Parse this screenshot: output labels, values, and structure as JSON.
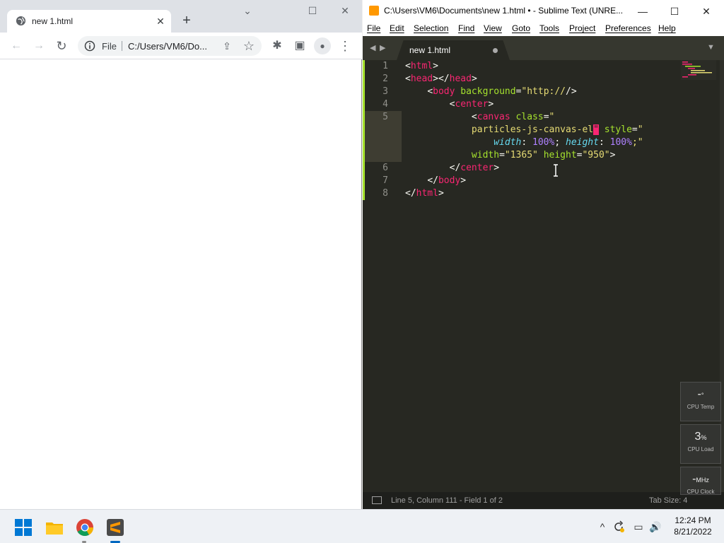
{
  "chrome": {
    "tab_title": "new 1.html",
    "tab_close": "✕",
    "new_tab": "+",
    "window_controls": {
      "minimize": "⌄",
      "maximize": "☐",
      "close": "✕"
    },
    "toolbar": {
      "back": "←",
      "forward": "→",
      "reload": "↻",
      "share": "⇪",
      "star": "☆",
      "extensions": "✱",
      "sidepanel": "▣",
      "profile": "●",
      "menu": "⋮"
    },
    "omnibox": {
      "scheme": "File",
      "url": "C:/Users/VM6/Do..."
    }
  },
  "sublime": {
    "title": "C:\\Users\\VM6\\Documents\\new 1.html • - Sublime Text (UNRE...",
    "window_controls": {
      "minimize": "—",
      "maximize": "☐",
      "close": "✕"
    },
    "menu": [
      "File",
      "Edit",
      "Selection",
      "Find",
      "View",
      "Goto",
      "Tools",
      "Project",
      "Preferences",
      "Help"
    ],
    "tab": {
      "label": "new 1.html",
      "nav_back": "◀",
      "nav_fwd": "▶",
      "more": "▼"
    },
    "line_numbers": [
      "1",
      "2",
      "3",
      "4",
      "5",
      "",
      "",
      "",
      "6",
      "7",
      "8"
    ],
    "code": {
      "l1": {
        "lt": "<",
        "tag": "html",
        "gt": ">"
      },
      "l2": {
        "lt": "<",
        "tag": "head",
        "mid": "></",
        "tag2": "head",
        "gt": ">"
      },
      "l3": {
        "indent": "    ",
        "lt": "<",
        "tag": "body",
        "sp": " ",
        "attr": "background",
        "eq": "=",
        "val": "\"http://",
        "gt": "/>"
      },
      "l4": {
        "indent": "        ",
        "lt": "<",
        "tag": "center",
        "gt": ">"
      },
      "l5a": {
        "indent": "            ",
        "lt": "<",
        "tag": "canvas",
        "sp": " ",
        "attr": "class",
        "eq": "=",
        "val": "\""
      },
      "l5b": {
        "indent": "            ",
        "val": "particles-js-canvas-el",
        "sel": "\"",
        "sp": " ",
        "attr": "style",
        "eq": "=",
        "val2": "\""
      },
      "l5c": {
        "indent": "                ",
        "prop": "width",
        "c1": ": ",
        "n1": "100%",
        "s1": "; ",
        "prop2": "height",
        "c2": ": ",
        "n2": "100%",
        "s2": ";\""
      },
      "l5d": {
        "indent": "            ",
        "attr": "width",
        "eq": "=",
        "val": "\"1365\"",
        "sp": " ",
        "attr2": "height",
        "eq2": "=",
        "val2": "\"950\"",
        "gt": ">"
      },
      "l6": {
        "indent": "        ",
        "lt": "</",
        "tag": "center",
        "gt": ">"
      },
      "l7": {
        "indent": "    ",
        "lt": "</",
        "tag": "body",
        "gt": ">"
      },
      "l8": {
        "lt": "</",
        "tag": "html",
        "gt": ">"
      }
    },
    "status": {
      "position": "Line 5, Column 111 - Field 1 of 2",
      "tab_size": "Tab Size: 4"
    }
  },
  "gadget": [
    {
      "value": "-",
      "unit": "°",
      "label": "CPU Temp"
    },
    {
      "value": "3",
      "unit": "%",
      "label": "CPU Load"
    },
    {
      "value": "-",
      "unit": "MHz",
      "label": "CPU Clock"
    }
  ],
  "taskbar": {
    "time": "12:24 PM",
    "date": "8/21/2022",
    "tray": {
      "chevron": "^",
      "network": "▭",
      "volume": "🔊"
    }
  },
  "colors": {
    "sublime_bg": "#272822",
    "tag": "#f92672",
    "attr": "#a6e22e",
    "string": "#e6db74",
    "number": "#ae81ff",
    "property": "#66d9ef"
  }
}
